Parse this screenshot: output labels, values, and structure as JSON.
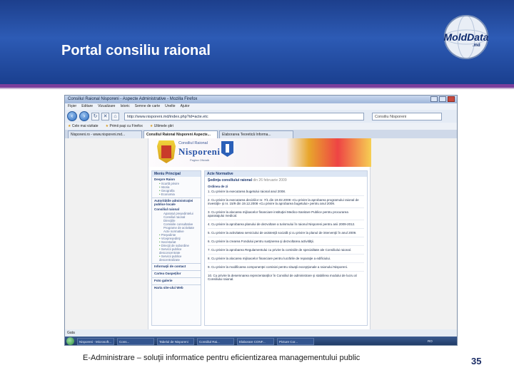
{
  "slide": {
    "title": "Portal consiliu raional",
    "logo_text": "MoldData",
    "logo_sub": ".md",
    "footer": "E-Administrare – soluţii informatice pentru eficientizarea managementului public",
    "page_number": "35"
  },
  "browser": {
    "title": "Consiliul Raional Nisporeni - Aspecte Administrative - Mozilla Firefox",
    "menu": [
      "Fişier",
      "Editare",
      "Vizualizare",
      "Istoric",
      "Semne de carte",
      "Unelte",
      "Ajutor"
    ],
    "url": "http://www.nisporeni.md/index.php?id=acte.etc",
    "search_value": "Consiliu Nisporeni",
    "bookmarks": [
      "Cele mai vizitate",
      "Primii paşi cu Firefox",
      "Ultimele ştiri"
    ],
    "tabs": [
      "Nisporeni.ro - www.nisporeni.md...",
      "Consiliul Raional Nisporeni Aspecte...",
      "Elaborarea Teoretică Informa..."
    ],
    "status": "Gata",
    "taskbar": [
      "Start",
      "Nisporeni - Microsoft...",
      "Cons...",
      "Tabelul de Nisporeni",
      "Consiliul Rai...",
      "Elaborare CONF...",
      "Picture Cor..."
    ],
    "tray": "RO"
  },
  "site": {
    "banner_small": "Consiliul Raional",
    "banner_big": "Nisporeni",
    "banner_tag": "Pagina Oficială",
    "sidebar": {
      "header": "Meniu Principal",
      "items": [
        {
          "label": "Despre Raion",
          "subs": [
            "Scurtă privire",
            "Istoria",
            "Geografia",
            "Economia"
          ]
        },
        {
          "label": "Autoritătile administraţiei publice locale",
          "subs": []
        },
        {
          "label": "Consiliul raional",
          "subs": [
            "Aparatul preşedintelui",
            "Consiliul raional",
            "Direcţiile",
            "Comisiile consultative",
            "Programe de activitate",
            "Acte normative"
          ]
        },
        {
          "label": "Preşedinte",
          "subs": []
        },
        {
          "label": "Vicepreşedinţi",
          "subs": []
        },
        {
          "label": "Secretariat",
          "subs": []
        },
        {
          "label": "Direcţii de subordine",
          "subs": []
        },
        {
          "label": "Servicii publice desconcentrate",
          "subs": []
        },
        {
          "label": "Servicii publice descentralizate",
          "subs": []
        },
        {
          "label": "Informaţii de contact",
          "subs": []
        },
        {
          "label": "Cartea Oaspeţilor",
          "subs": []
        },
        {
          "label": "Foto galerie",
          "subs": []
        },
        {
          "label": "Harta site-ului Web",
          "subs": []
        }
      ]
    },
    "main": {
      "header": "Acte Normative",
      "title": "Şedinţa consiliului raional",
      "title_date": "din 26 februarie 2009",
      "subtitle": "Ordinea de zi",
      "lines": [
        "1. Cu privire la executarea bugetului raional anul 2008.",
        "2. Cu privire la executarea deciziilor nr. 7/1 din 19.02.2008 «Cu privire la aprobarea programului raional de investiţii» şi nr. 15/9 din 19.12.2008 «Cu privire la aprobarea bugetului» pentru anul 2009.",
        "3. Cu privire la alocarea mijloacelor financiare instituţiei Medico-Sanitare Publice pentru procurarea aparatajului medical.",
        "4. Cu privire la aprobarea planului de dezvoltare a turismului în raionul Nisporeni pentru anii 2009-2012.",
        "5. Cu privire la activitatea serviciului de asistenţă socială şi cu privire la planul de intervenţii în anul 2009.",
        "6. Cu privire la crearea Fondului pentru susţinerea şi dezvoltarea activităţii.",
        "7. Cu privire la aprobarea Regulamentului cu privire la comisiile de specialitate ale Consiliului raional.",
        "8. Cu privire la alocarea mijloacelor financiare pentru lucrările de reparaţie a edificiului.",
        "9. Cu privire la modificarea componenţei comisiei pentru situaţii excepţionale a raionului Nisporeni.",
        "10. Cu privire la desemnarea reprezentanţilor în Consiliul de administrare şi stabilirea modului de lucru al Consiliului raional."
      ]
    }
  }
}
